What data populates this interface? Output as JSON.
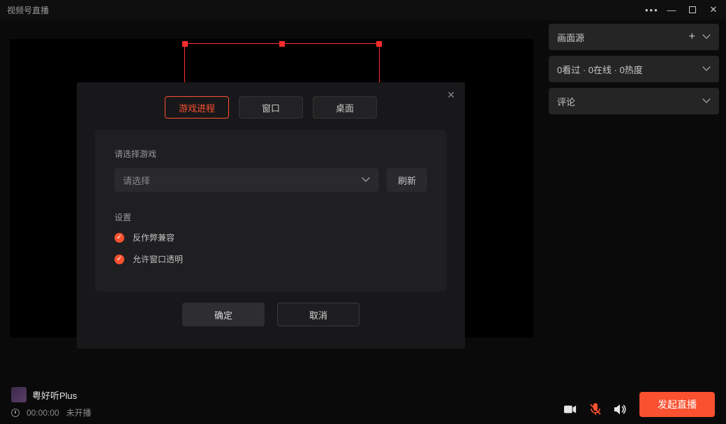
{
  "window": {
    "title": "视频号直播"
  },
  "rightPanels": {
    "source_label": "画面源",
    "stats_label": "0看过 · 0在线 · 0热度",
    "comments_label": "评论"
  },
  "modal": {
    "tabs": {
      "game": "游戏进程",
      "window": "窗口",
      "desktop": "桌面"
    },
    "select_game_label": "请选择游戏",
    "select_placeholder": "请选择",
    "refresh": "刷新",
    "settings_label": "设置",
    "opt_anticheat": "反作弊兼容",
    "opt_transparent": "允许窗口透明",
    "ok": "确定",
    "cancel": "取消"
  },
  "bottom": {
    "username": "粤好听Plus",
    "time": "00:00:00",
    "status": "未开播",
    "startButton": "发起直播"
  }
}
